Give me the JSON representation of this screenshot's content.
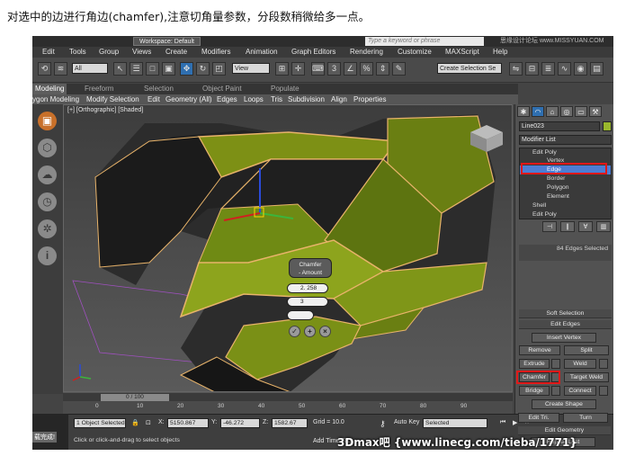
{
  "caption": "对选中的边进行角边(chamfer),注意切角量参数，分段数稍微给多一点。",
  "titlebar": {
    "workspace": "Workspace: Default",
    "search_placeholder": "Type a keyword or phrase",
    "watermark": "思缘设计论坛 www.MISSYUAN.COM"
  },
  "menu": [
    "Edit",
    "Tools",
    "Group",
    "Views",
    "Create",
    "Modifiers",
    "Animation",
    "Graph Editors",
    "Rendering",
    "Customize",
    "MAXScript",
    "Help"
  ],
  "toolbar": {
    "filter": "All",
    "view": "View",
    "selection_set": "Create Selection Se"
  },
  "ribbon": {
    "tabs": [
      "Modeling",
      "Freeform",
      "Selection",
      "Object Paint",
      "Populate"
    ],
    "panels": [
      "ygon Modeling",
      "Modify Selection",
      "Edit",
      "Geometry (All)",
      "Edges",
      "Loops",
      "Tris",
      "Subdivision",
      "Align",
      "Properties"
    ]
  },
  "viewport": {
    "label": "[+] [Orthographic] [Shaded]",
    "caddy": {
      "title": "Chamfer",
      "subtitle": "- Amount",
      "amount": "2. 258",
      "segments": "3"
    }
  },
  "timeline": {
    "frame": "0 / 100",
    "ticks": [
      "0",
      "10",
      "20",
      "30",
      "40",
      "50",
      "60",
      "70",
      "80",
      "90"
    ]
  },
  "status": {
    "selected": "1 Object Selected",
    "x_label": "X:",
    "x_value": "5150.867",
    "y_label": "Y:",
    "y_value": "-46.272",
    "z_label": "Z:",
    "z_value": "1582.67",
    "grid": "Grid = 10.0",
    "autokey": "Auto Key",
    "setkey_mode": "Selected",
    "add_time_tag": "Add Time Tag",
    "prompt": "Click or click-and-drag to select objects",
    "done": "载完成!"
  },
  "command_panel": {
    "object_name": "Line023",
    "object_color": "#9ab82d",
    "modifier_list": "Modifier List",
    "stack": [
      "Edit Poly",
      "Vertex",
      "Edge",
      "Border",
      "Polygon",
      "Element",
      "Shell",
      "Edit Poly"
    ],
    "selected_stack_item": "Edge",
    "edges_selected": "84 Edges Selected",
    "rollouts": {
      "soft_selection": "Soft Selection",
      "edit_edges": "Edit Edges",
      "edit_geometry": "Edit Geometry",
      "repeat_last": "Repeat Last"
    },
    "buttons": {
      "insert_vertex": "Insert Vertex",
      "remove": "Remove",
      "split": "Split",
      "extrude": "Extrude",
      "weld": "Weld",
      "chamfer": "Chamfer",
      "target_weld": "Target Weld",
      "bridge": "Bridge",
      "connect": "Connect",
      "create_shape": "Create Shape",
      "edit_tri": "Edit Tri.",
      "turn": "Turn"
    }
  },
  "site_watermark": "3Dmax吧 {www.linecg.com/tieba/1771}"
}
